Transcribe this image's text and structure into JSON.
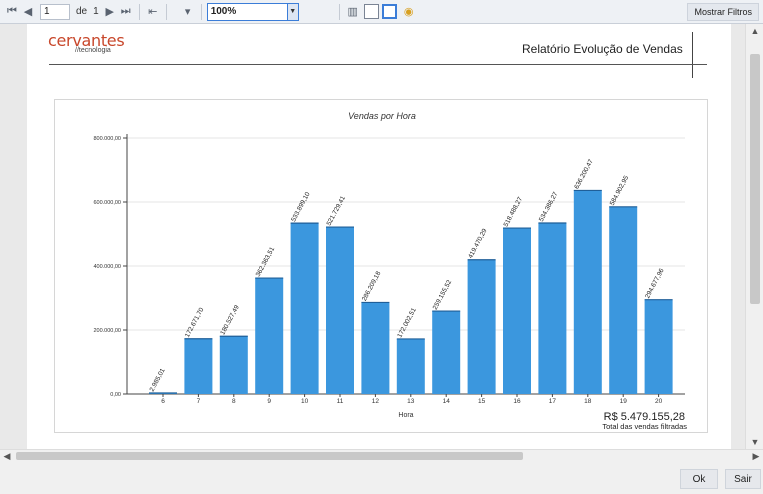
{
  "toolbar": {
    "page_value": "1",
    "of_label": "de",
    "total_pages": "1",
    "zoom": "100%",
    "filters_label": "Mostrar Filtros"
  },
  "report": {
    "logo_main": "cervantes",
    "logo_sub": "//tecnologia",
    "title": "Relatório Evolução de Vendas"
  },
  "chart_data": {
    "type": "bar",
    "title": "Vendas por Hora",
    "xlabel": "Hora",
    "ylabel": "",
    "categories": [
      "6",
      "7",
      "8",
      "9",
      "10",
      "11",
      "12",
      "13",
      "14",
      "15",
      "16",
      "17",
      "18",
      "19",
      "20"
    ],
    "values": [
      2985.01,
      172671.7,
      180527.49,
      362363.51,
      533899.1,
      521729.41,
      286209.18,
      172002.51,
      259155.52,
      419470.29,
      518488.27,
      534386.27,
      636200.47,
      584902.95,
      294677.96
    ],
    "value_labels": [
      "2.985,01",
      "172.671,70",
      "180.527,49",
      "362.363,51",
      "533.899,10",
      "521.729,41",
      "286.209,18",
      "172.002,51",
      "259.155,52",
      "419.470,29",
      "518.488,27",
      "534.386,27",
      "636.200,47",
      "584.902,95",
      "294.677,96"
    ],
    "yticks": [
      0,
      200000,
      400000,
      600000,
      800000
    ],
    "ytick_labels": [
      "0,00",
      "200.000,00",
      "400.000,00",
      "600.000,00",
      "800.000,00"
    ],
    "ylim": [
      0,
      800000
    ],
    "grid": true,
    "bar_color": "#3b97de",
    "total_value": "R$ 5.479.155,28",
    "total_label": "Total das vendas filtradas"
  },
  "footer": {
    "ok_label": "Ok",
    "exit_label": "Sair"
  }
}
